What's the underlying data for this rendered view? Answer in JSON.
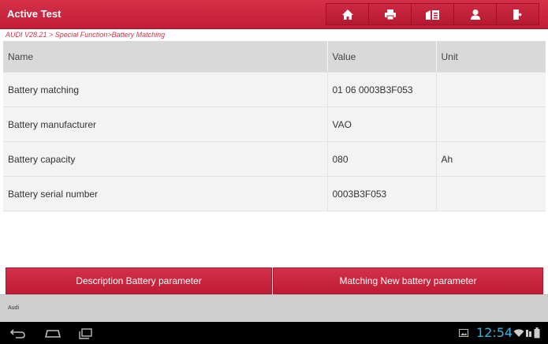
{
  "header": {
    "title": "Active Test",
    "icons": [
      "home-icon",
      "print-icon",
      "report-icon",
      "user-icon",
      "exit-icon"
    ]
  },
  "breadcrumb": "AUDI V28.21 > Special Function>Battery Matching",
  "table": {
    "columns": [
      "Name",
      "Value",
      "Unit"
    ],
    "rows": [
      {
        "name": "Battery matching",
        "value": "01 06 0003B3F053",
        "unit": ""
      },
      {
        "name": "Battery manufacturer",
        "value": "VAO",
        "unit": ""
      },
      {
        "name": "Battery capacity",
        "value": "080",
        "unit": "Ah"
      },
      {
        "name": "Battery serial number",
        "value": "0003B3F053",
        "unit": ""
      }
    ]
  },
  "actions": {
    "description_label": "Description  Battery parameter",
    "matching_label": "Matching  New battery parameter"
  },
  "status": {
    "vehicle": "Audi"
  },
  "system": {
    "clock": "12:54"
  },
  "colors": {
    "accent": "#c8223a",
    "clock": "#33b5e5"
  }
}
